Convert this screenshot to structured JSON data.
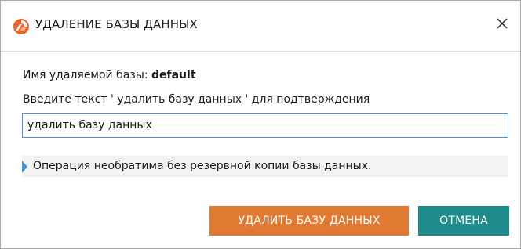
{
  "window": {
    "title": "УДАЛЕНИЕ БАЗЫ ДАННЫХ",
    "icon": "app-logo-icon",
    "close_icon": "close-icon"
  },
  "form": {
    "dbname_label": "Имя удаляемой базы: ",
    "dbname_value": "default",
    "prompt": "Введите текст ' удалить базу данных ' для подтверждения",
    "input_value": "удалить базу данных"
  },
  "info": {
    "message": "Операция необратима без резервной копии базы данных."
  },
  "buttons": {
    "delete_label": "УДАЛИТЬ БАЗУ ДАННЫХ",
    "cancel_label": "ОТМЕНА"
  },
  "colors": {
    "delete_button": "#e07a33",
    "cancel_button": "#1e8a8a",
    "input_border": "#4a90d9",
    "info_marker": "#4a90d9",
    "logo_orange": "#e8652a"
  }
}
